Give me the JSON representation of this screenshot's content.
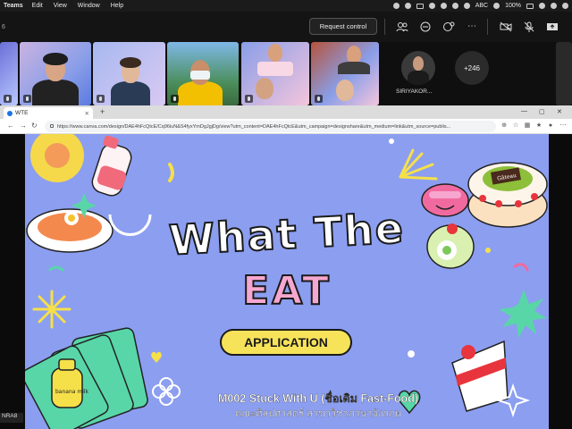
{
  "menubar": {
    "app": "Teams",
    "items": [
      "Edit",
      "View",
      "Window",
      "Help"
    ],
    "status_text": "ABC",
    "battery": "100%"
  },
  "teams": {
    "left_label": "6",
    "request_control": "Request control"
  },
  "participants": {
    "named_avatar": "SIRIYAKOR...",
    "overflow_count": "+246",
    "bottom_name": "NRA8"
  },
  "browser": {
    "tab_title": "WTE",
    "new_tab": "+",
    "url": "https://www.canva.com/design/DAE4hFcQtcE/Cq96iuN&S4fyxYmDgJgjDg/view?utm_content=DAE4hFcQtcE&utm_campaign=designshare&utm_medium=link&utm_source=publis..."
  },
  "slide": {
    "title_line1": "What The",
    "title_line2": "EAT",
    "subtitle": "APPLICATION",
    "course": "M002 Stuck With U (ชื่อเดิม Fast-Food)",
    "faculty": "คณะศิลปศาสตร์ สาขาวิชาภาษาอังกฤษ",
    "bottle_label": "banana milk",
    "cake_label": "Gâteau"
  },
  "colors": {
    "slide_bg": "#8c9ef0",
    "title_pink": "#f7a7cf",
    "pill_yellow": "#f7e35a"
  }
}
